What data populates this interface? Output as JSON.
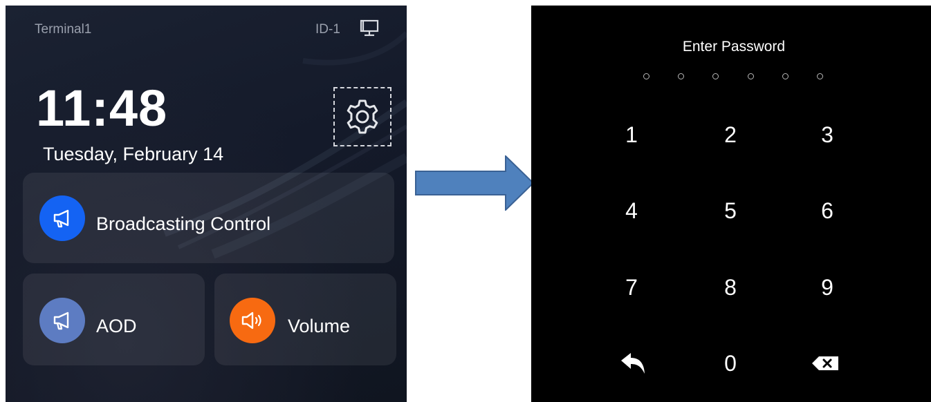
{
  "terminal": {
    "name": "Terminal1",
    "id": "ID-1",
    "time": "11:48",
    "date": "Tuesday, February 14",
    "tiles": [
      {
        "label": "Broadcasting Control",
        "icon": "megaphone-icon",
        "color": "#1463f3"
      },
      {
        "label": "AOD",
        "icon": "megaphone-icon",
        "color": "#5d7cc2"
      },
      {
        "label": "Volume",
        "icon": "speaker-icon",
        "color": "#f76a11"
      }
    ]
  },
  "transition": {
    "icon": "right-arrow-icon",
    "color": "#4f81bd"
  },
  "keypad": {
    "title": "Enter Password",
    "pin_length": 6,
    "keys": [
      "1",
      "2",
      "3",
      "4",
      "5",
      "6",
      "7",
      "8",
      "9",
      "0"
    ],
    "back_icon": "reply-arrow-icon",
    "delete_icon": "backspace-icon"
  }
}
